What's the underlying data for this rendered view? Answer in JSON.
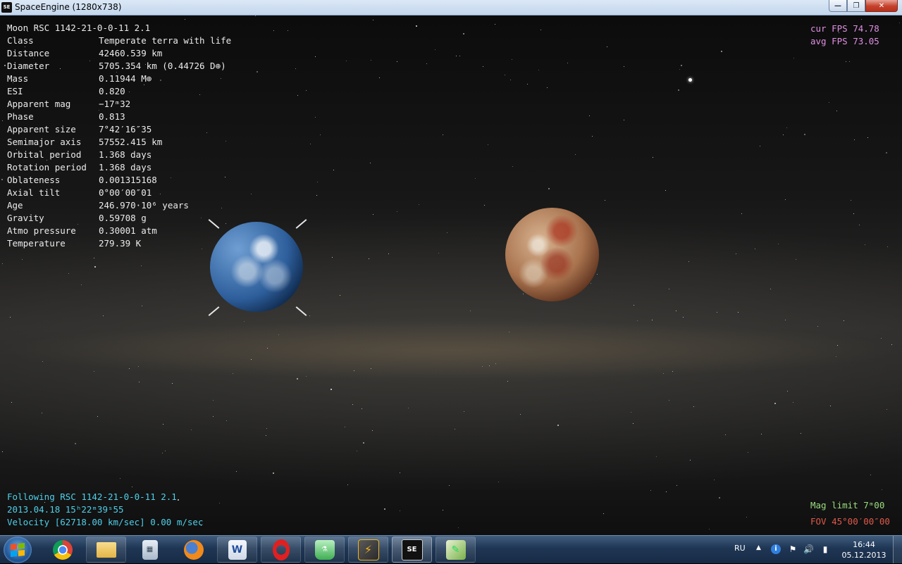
{
  "window": {
    "title": "SpaceEngine (1280x738)",
    "icon_text": "SE",
    "minimize_glyph": "—",
    "maximize_glyph": "❐",
    "close_glyph": "✕"
  },
  "object_info": {
    "header": "Moon  RSC 1142-21-0-0-11 2.1",
    "rows": [
      {
        "label": "Class",
        "value": "Temperate terra with life"
      },
      {
        "label": "Distance",
        "value": "42460.539 km"
      },
      {
        "label": "Diameter",
        "value": "5705.354 km (0.44726 D⊕)"
      },
      {
        "label": "Mass",
        "value": "0.11944 M⊕"
      },
      {
        "label": "ESI",
        "value": "0.820"
      },
      {
        "label": "Apparent mag",
        "value": "−17ᵐ32"
      },
      {
        "label": "Phase",
        "value": "0.813"
      },
      {
        "label": "Apparent size",
        "value": "7°42′16″35"
      },
      {
        "label": "Semimajor axis",
        "value": "57552.415 km"
      },
      {
        "label": "Orbital period",
        "value": "1.368 days"
      },
      {
        "label": "Rotation period",
        "value": "1.368 days"
      },
      {
        "label": "Oblateness",
        "value": "0.001315168"
      },
      {
        "label": "Axial tilt",
        "value": "0°00′00″01"
      },
      {
        "label": "Age",
        "value": "246.970·10⁶ years"
      },
      {
        "label": "Gravity",
        "value": "0.59708 g"
      },
      {
        "label": "Atmo pressure",
        "value": "0.30001 atm"
      },
      {
        "label": "Temperature",
        "value": "279.39 K"
      }
    ]
  },
  "fps": {
    "cur": "cur FPS 74.78",
    "avg": "avg FPS 73.05"
  },
  "status": {
    "following": "Following RSC 1142-21-0-0-11 2.1",
    "datetime": "2013.04.18 15ʰ22ᵐ39ˢ55",
    "velocity": "Velocity [62718.00 km/sec] 0.00 m/sec",
    "mag_limit": "Mag limit  7ᵐ00",
    "fov": "FOV 45°00′00″00"
  },
  "taskbar": {
    "buttons": [
      {
        "name": "chrome",
        "glyph": ""
      },
      {
        "name": "explorer",
        "glyph": ""
      },
      {
        "name": "calculator",
        "glyph": "▦"
      },
      {
        "name": "firefox",
        "glyph": ""
      },
      {
        "name": "word",
        "glyph": "W"
      },
      {
        "name": "opera",
        "glyph": ""
      },
      {
        "name": "flask-app",
        "glyph": "⚗"
      },
      {
        "name": "sparkle-app",
        "glyph": "⚡"
      },
      {
        "name": "spaceengine",
        "glyph": "SE"
      },
      {
        "name": "paint-app",
        "glyph": "✎"
      }
    ],
    "tray": {
      "language": "RU",
      "expand_glyph": "▲",
      "info_glyph": "i",
      "flag_glyph": "⚑",
      "volume_glyph": "🔊",
      "network_glyph": "▮",
      "time": "16:44",
      "date": "05.12.2013"
    }
  },
  "colors": {
    "hud_text": "#ececec",
    "fps_text": "#e08fe2",
    "status_text": "#4fd0ea",
    "mag_text": "#9bdd7e",
    "fov_text": "#e05a4a"
  }
}
